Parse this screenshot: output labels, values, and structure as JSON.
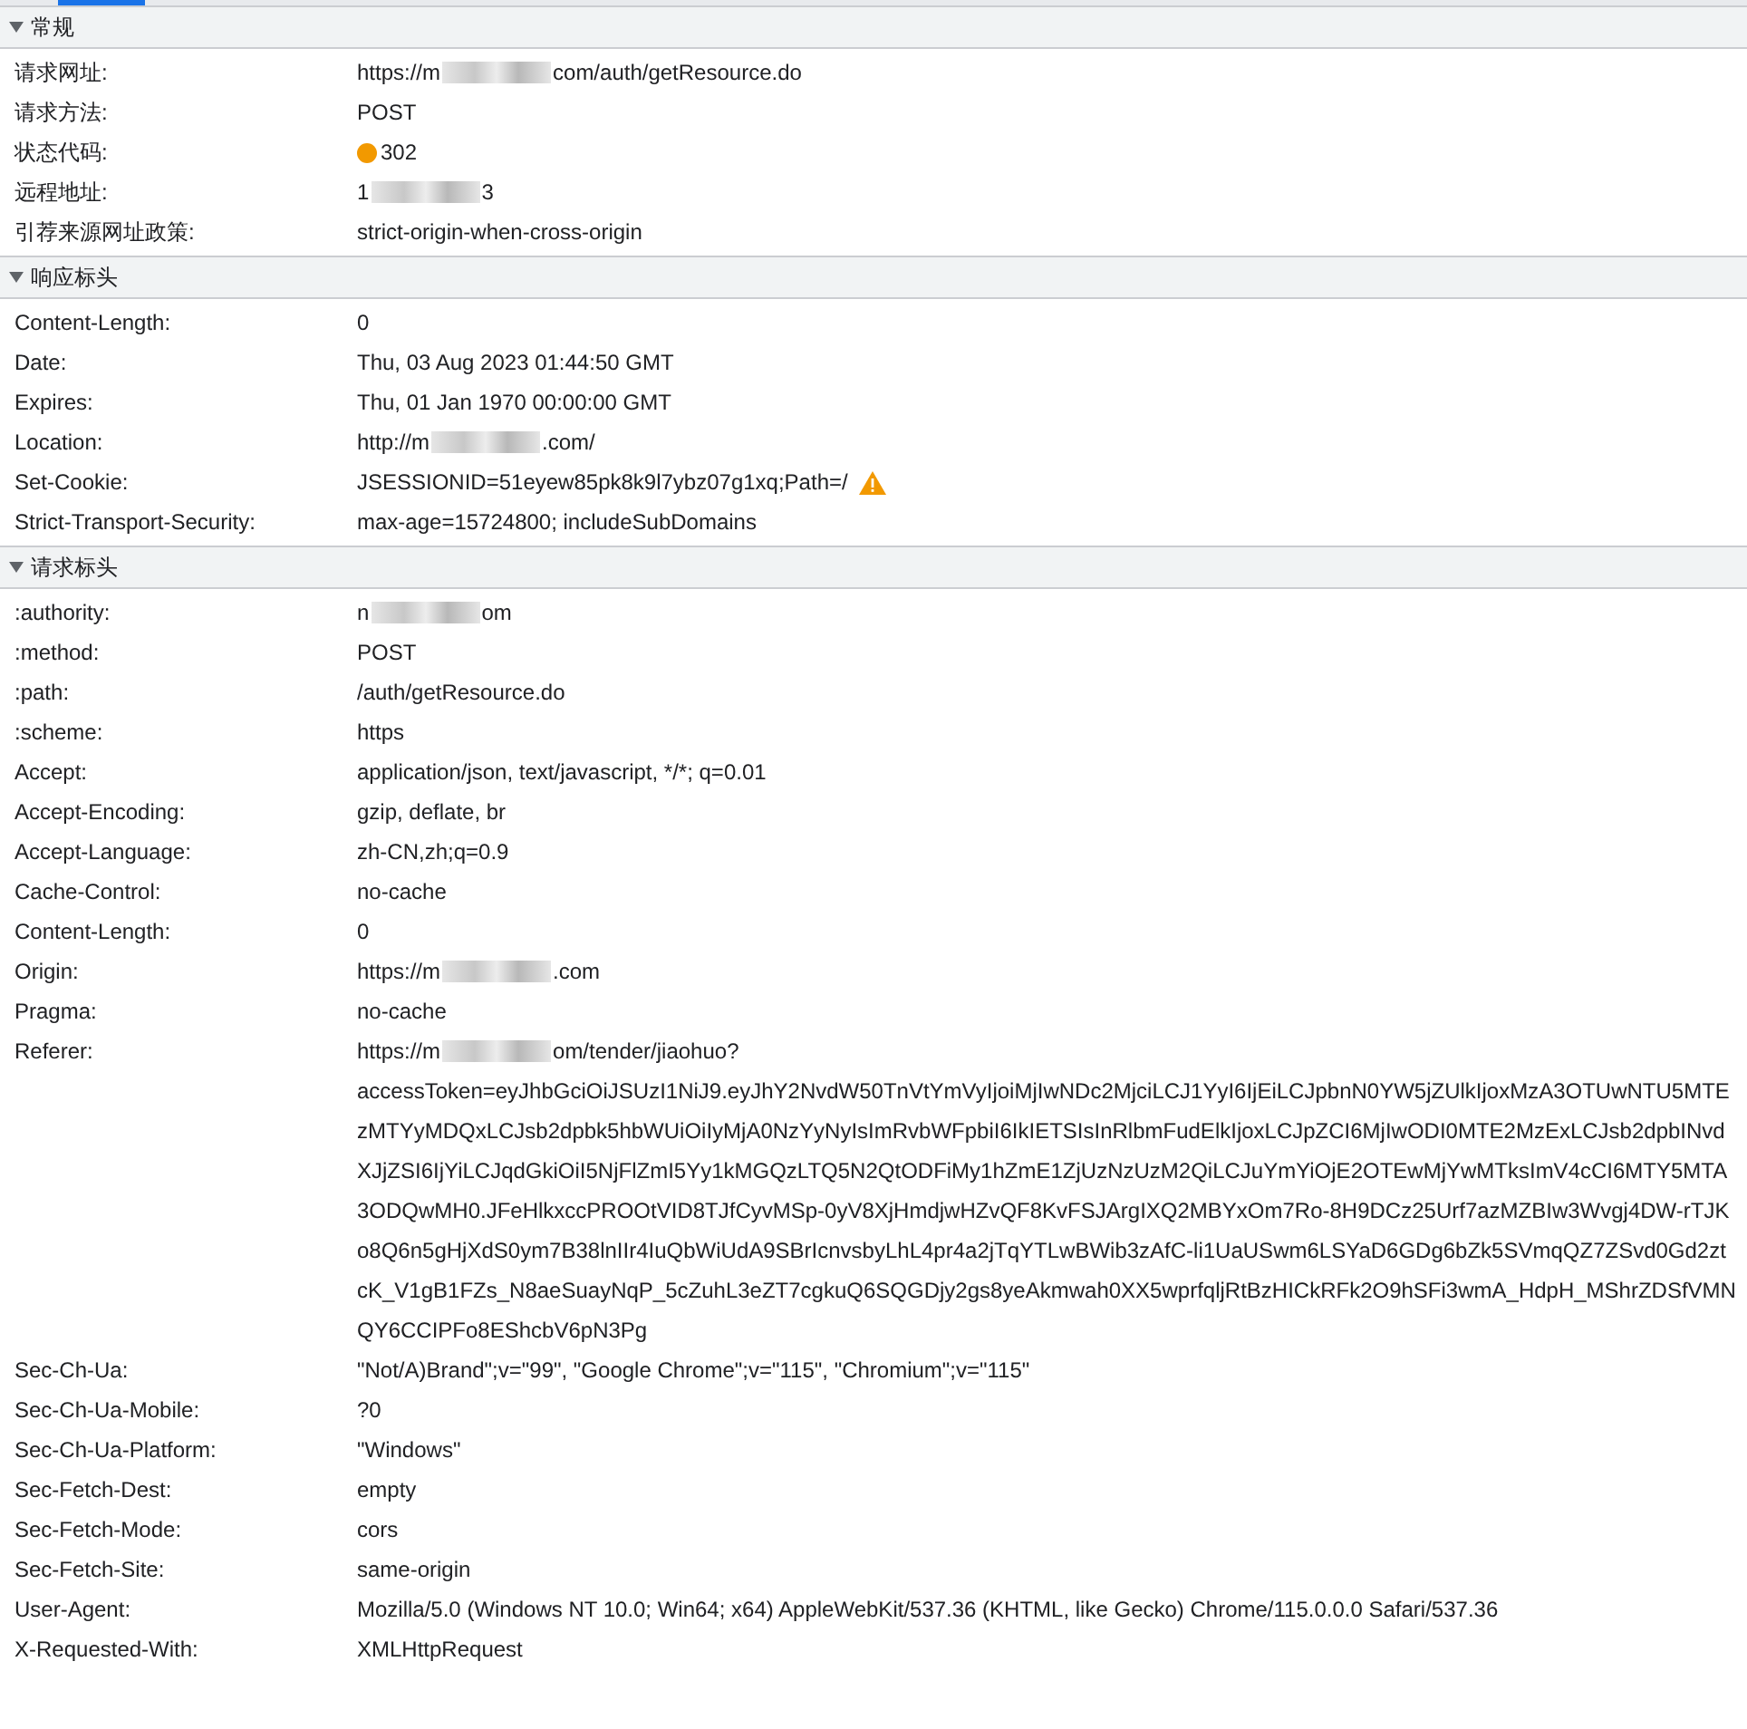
{
  "sections": [
    {
      "title": "常规",
      "expanded": true,
      "rows": [
        {
          "name": "请求网址:",
          "parts": [
            "https://m",
            "com/auth/getResource.do"
          ]
        },
        {
          "name": "请求方法:",
          "value": "POST"
        },
        {
          "name": "状态代码:",
          "value": "302",
          "color": "#f29900"
        },
        {
          "name": "远程地址:",
          "parts": [
            "1",
            "3"
          ]
        },
        {
          "name": "引荐来源网址政策:",
          "value": "strict-origin-when-cross-origin"
        }
      ]
    },
    {
      "title": "响应标头",
      "expanded": true,
      "rows": [
        {
          "name": "Content-Length:",
          "value": "0"
        },
        {
          "name": "Date:",
          "value": "Thu, 03 Aug 2023 01:44:50 GMT"
        },
        {
          "name": "Expires:",
          "value": "Thu, 01 Jan 1970 00:00:00 GMT"
        },
        {
          "name": "Location:",
          "parts": [
            "http://m",
            ".com/"
          ]
        },
        {
          "name": "Set-Cookie:",
          "value": "JSESSIONID=51eyew85pk8k9l7ybz07g1xq;Path=/",
          "warning": true
        },
        {
          "name": "Strict-Transport-Security:",
          "value": "max-age=15724800; includeSubDomains"
        }
      ]
    },
    {
      "title": "请求标头",
      "expanded": true,
      "rows": [
        {
          "name": ":authority:",
          "parts": [
            "n",
            "om"
          ]
        },
        {
          "name": ":method:",
          "value": "POST"
        },
        {
          "name": ":path:",
          "value": "/auth/getResource.do"
        },
        {
          "name": ":scheme:",
          "value": "https"
        },
        {
          "name": "Accept:",
          "value": "application/json, text/javascript, */*; q=0.01"
        },
        {
          "name": "Accept-Encoding:",
          "value": "gzip, deflate, br"
        },
        {
          "name": "Accept-Language:",
          "value": "zh-CN,zh;q=0.9"
        },
        {
          "name": "Cache-Control:",
          "value": "no-cache"
        },
        {
          "name": "Content-Length:",
          "value": "0"
        },
        {
          "name": "Origin:",
          "parts": [
            "https://m",
            ".com"
          ]
        },
        {
          "name": "Pragma:",
          "value": "no-cache"
        },
        {
          "name": "Referer:",
          "parts": [
            "https://m",
            "om/tender/jiaohuo?"
          ],
          "continuation": "accessToken=eyJhbGciOiJSUzI1NiJ9.eyJhY2NvdW50TnVtYmVyIjoiMjIwNDc2MjciLCJ1YyI6IjEiLCJpbnN0YW5jZUlkIjoxMzA3OTUwNTU5MTEzMTYyMDQxLCJsb2dpbk5hbWUiOiIyMjA0NzYyNyIsImRvbWFpbiI6IkIETSIsInRlbmFudElkIjoxLCJpZCI6MjIwODI0MTE2MzExLCJsb2dpbINvdXJjZSI6IjYiLCJqdGkiOiI5NjFlZmI5Yy1kMGQzLTQ5N2QtODFiMy1hZmE1ZjUzNzUzM2QiLCJuYmYiOjE2OTEwMjYwMTksImV4cCI6MTY5MTA3ODQwMH0.JFeHlkxccPROOtVID8TJfCyvMSp-0yV8XjHmdjwHZvQF8KvFSJArgIXQ2MBYxOm7Ro-8H9DCz25Urf7azMZBIw3Wvgj4DW-rTJKo8Q6n5gHjXdS0ym7B38lnIIr4IuQbWiUdA9SBrIcnvsbyLhL4pr4a2jTqYTLwBWib3zAfC-li1UaUSwm6LSYaD6GDg6bZk5SVmqQZ7ZSvd0Gd2ztcK_V1gB1FZs_N8aeSuayNqP_5cZuhL3eZT7cgkuQ6SQGDjy2gs8yeAkmwah0XX5wprfqljRtBzHICkRFk2O9hSFi3wmA_HdpH_MShrZDSfVMNQY6CCIPFo8EShcbV6pN3Pg"
        },
        {
          "name": "Sec-Ch-Ua:",
          "value": "\"Not/A)Brand\";v=\"99\", \"Google Chrome\";v=\"115\", \"Chromium\";v=\"115\""
        },
        {
          "name": "Sec-Ch-Ua-Mobile:",
          "value": "?0"
        },
        {
          "name": "Sec-Ch-Ua-Platform:",
          "value": "\"Windows\""
        },
        {
          "name": "Sec-Fetch-Dest:",
          "value": "empty"
        },
        {
          "name": "Sec-Fetch-Mode:",
          "value": "cors"
        },
        {
          "name": "Sec-Fetch-Site:",
          "value": "same-origin"
        },
        {
          "name": "User-Agent:",
          "value": "Mozilla/5.0 (Windows NT 10.0; Win64; x64) AppleWebKit/537.36 (KHTML, like Gecko) Chrome/115.0.0.0 Safari/537.36"
        },
        {
          "name": "X-Requested-With:",
          "value": "XMLHttpRequest"
        }
      ]
    }
  ]
}
